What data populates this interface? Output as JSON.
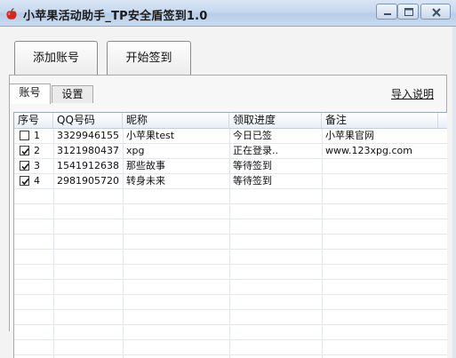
{
  "window": {
    "title": "小苹果活动助手_TP安全盾签到1.0",
    "controls": [
      "minimize",
      "maximize",
      "close"
    ]
  },
  "toolbar": {
    "add_account_label": "添加账号",
    "start_signin_label": "开始签到"
  },
  "tabs": [
    {
      "label": "账号",
      "active": true
    },
    {
      "label": "设置",
      "active": false
    }
  ],
  "import_link_label": "导入说明",
  "table": {
    "columns": [
      "序号",
      "QQ号码",
      "昵称",
      "领取进度",
      "备注"
    ],
    "rows": [
      {
        "checked": false,
        "index": "1",
        "qq": "3329946155",
        "nickname": "小苹果test",
        "progress": "今日已签",
        "note": "小苹果官网"
      },
      {
        "checked": true,
        "index": "2",
        "qq": "3121980437",
        "nickname": "xpg",
        "progress": "正在登录..",
        "note": "www.123xpg.com"
      },
      {
        "checked": true,
        "index": "3",
        "qq": "1541912638",
        "nickname": "那些故事",
        "progress": "等待签到",
        "note": ""
      },
      {
        "checked": true,
        "index": "4",
        "qq": "2981905720",
        "nickname": "转身未来",
        "progress": "等待签到",
        "note": ""
      }
    ]
  },
  "icons": {
    "app": "apple-icon",
    "minimize": "minimize-icon",
    "maximize": "maximize-icon",
    "close": "close-icon"
  },
  "colors": {
    "titlebar": "#c7d9ee",
    "app_icon": "#d8241b"
  }
}
